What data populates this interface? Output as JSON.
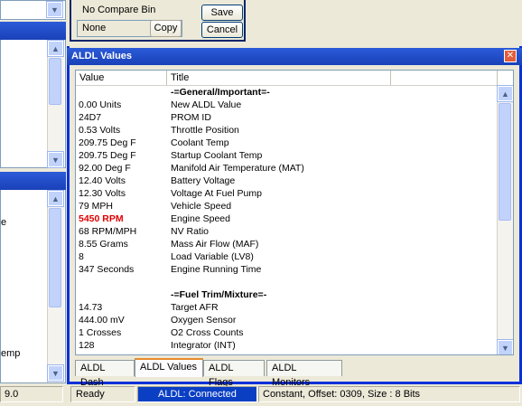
{
  "compare": {
    "no_compare_label": "No Compare Bin",
    "none_value": "None",
    "copy_label": "Copy",
    "save_label": "Save",
    "cancel_label": "Cancel"
  },
  "aldl_window": {
    "title": "ALDL Values",
    "close_label": "✕",
    "columns": [
      "Value",
      "Title"
    ],
    "rows": [
      {
        "value": "",
        "title": "-=General/Important=-",
        "section": true
      },
      {
        "value": "0.00 Units",
        "title": "New ALDL Value"
      },
      {
        "value": "24D7",
        "title": "PROM ID"
      },
      {
        "value": "0.53 Volts",
        "title": "Throttle Position"
      },
      {
        "value": "209.75 Deg F",
        "title": "Coolant Temp"
      },
      {
        "value": "209.75 Deg F",
        "title": "Startup Coolant Temp"
      },
      {
        "value": "92.00 Deg F",
        "title": "Manifold Air Temperature (MAT)"
      },
      {
        "value": "12.40 Volts",
        "title": "Battery Voltage"
      },
      {
        "value": "12.30 Volts",
        "title": "Voltage At Fuel Pump"
      },
      {
        "value": "79 MPH",
        "title": "Vehicle Speed"
      },
      {
        "value": "5450 RPM",
        "title": "Engine Speed",
        "alert": true
      },
      {
        "value": "68 RPM/MPH",
        "title": "NV Ratio"
      },
      {
        "value": "8.55 Grams",
        "title": "Mass Air Flow (MAF)"
      },
      {
        "value": "8",
        "title": "Load Variable (LV8)"
      },
      {
        "value": "347 Seconds",
        "title": "Engine Running Time"
      },
      {
        "value": "",
        "title": ""
      },
      {
        "value": "",
        "title": "-=Fuel Trim/Mixture=-",
        "section": true
      },
      {
        "value": "14.73",
        "title": "Target AFR"
      },
      {
        "value": "444.00 mV",
        "title": "Oxygen Sensor"
      },
      {
        "value": "1 Crosses",
        "title": "O2 Cross Counts"
      },
      {
        "value": "128",
        "title": "Integrator (INT)"
      }
    ]
  },
  "tabs": [
    "ALDL Dash",
    "ALDL Values",
    "ALDL Flags",
    "ALDL Monitors"
  ],
  "active_tab": "ALDL Values",
  "left_panel": {
    "partial_text_1": "e",
    "partial_text_2": "emp"
  },
  "status_bar": {
    "left_partial": "9.0",
    "ready": "Ready",
    "connection": "ALDL: Connected",
    "info": "Constant, Offset: 0309,  Size : 8 Bits"
  },
  "colors": {
    "alert": "#e00000",
    "connected_bg": "#0a3fc4"
  }
}
